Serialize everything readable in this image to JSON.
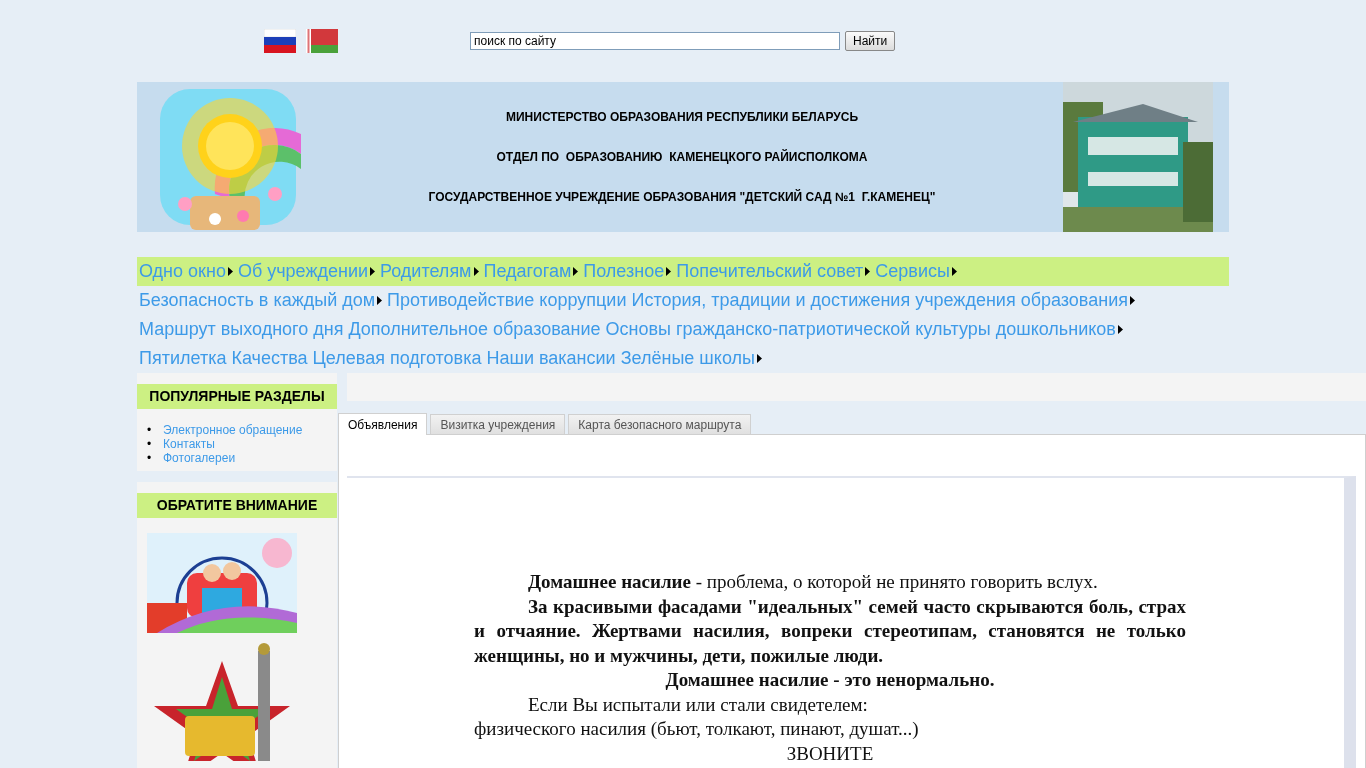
{
  "languages": [
    {
      "kind": "ru"
    },
    {
      "kind": "by"
    }
  ],
  "search": {
    "placeholder": "поиск по сайту",
    "button": "Найти"
  },
  "header": {
    "lines": [
      "МИНИСТЕРСТВО ОБРАЗОВАНИЯ РЕСПУБЛИКИ БЕЛАРУСЬ",
      "ОТДЕЛ ПО  ОБРАЗОВАНИЮ  КАМЕНЕЦКОГО РАЙИСПОЛКОМА",
      "ГОСУДАРСТВЕННОЕ УЧРЕЖДЕНИЕ ОБРАЗОВАНИЯ \"ДЕТСКИЙ САД №1  Г.КАМЕНЕЦ\""
    ]
  },
  "menu": [
    {
      "highlighted": true,
      "items": [
        {
          "label": "Одно окно",
          "submenu": true
        },
        {
          "label": "Об учреждении",
          "submenu": true
        },
        {
          "label": "Родителям",
          "submenu": true
        },
        {
          "label": "Педагогам",
          "submenu": true
        },
        {
          "label": "Полезное",
          "submenu": true
        },
        {
          "label": "Попечительский совет",
          "submenu": true
        },
        {
          "label": "Сервисы",
          "submenu": true
        }
      ]
    },
    {
      "highlighted": false,
      "items": [
        {
          "label": "Безопасность в каждый дом",
          "submenu": true
        },
        {
          "label": "Противодействие коррупции",
          "submenu": false
        },
        {
          "label": "История, традиции и достижения учреждения образования",
          "submenu": true
        }
      ]
    },
    {
      "highlighted": false,
      "items": [
        {
          "label": "Маршрут выходного дня",
          "submenu": false
        },
        {
          "label": "Дополнительное образование",
          "submenu": false
        },
        {
          "label": "Основы гражданско-патриотической культуры дошкольников",
          "submenu": true
        }
      ]
    },
    {
      "highlighted": false,
      "items": [
        {
          "label": "Пятилетка Качества",
          "submenu": false
        },
        {
          "label": "Целевая подготовка",
          "submenu": false
        },
        {
          "label": "Наши вакансии",
          "submenu": false
        },
        {
          "label": "Зелёные школы",
          "submenu": true
        }
      ]
    }
  ],
  "sidebar": {
    "popular": {
      "title": "ПОПУЛЯРНЫЕ РАЗДЕЛЫ",
      "links": [
        {
          "marker": "•",
          "label": "Электронное обращение"
        },
        {
          "marker": "•",
          "label": "Контакты"
        },
        {
          "marker": "•",
          "label": "Фотогалереи"
        }
      ]
    },
    "attention": {
      "title": "ОБРАТИТЕ ВНИМАНИЕ"
    }
  },
  "tabs": [
    {
      "label": "Объявления",
      "selected": true
    },
    {
      "label": "Визитка учреждения",
      "selected": false
    },
    {
      "label": "Карта безопасного маршрута",
      "selected": false
    }
  ],
  "document": {
    "paragraphs": [
      {
        "kind": "indent",
        "text": "**Домашнее насилие** - проблема, о которой не принято говорить вслух."
      },
      {
        "kind": "justify",
        "text": "За красивыми фасадами \"идеальных\" семей часто скрываются боль, страх и отчаяние. Жертвами насилия, вопреки стереотипам, становятся не только женщины, но и мужчины, дети, пожилые люди."
      },
      {
        "kind": "center-bold",
        "text": "Домашнее насилие - это ненормально."
      },
      {
        "kind": "indent",
        "text": "Если Вы испытали или стали свидетелем:"
      },
      {
        "kind": "plain",
        "text": "физического насилия (бьют, толкают, пинают, душат...)"
      },
      {
        "kind": "center",
        "text": "ЗВОНИТЕ"
      }
    ]
  }
}
